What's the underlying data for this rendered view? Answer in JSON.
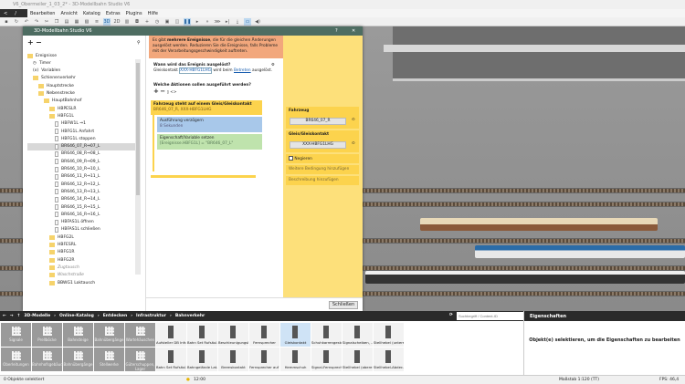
{
  "window": {
    "title": "V6_Obermeiler_1_03_2* - 3D-Modellbahn Studio V6"
  },
  "menu": [
    "Bearbeiten",
    "Ansicht",
    "Katalog",
    "Extras",
    "Plugins",
    "Hilfe"
  ],
  "dialog": {
    "title": "3D-Modellbahn Studio V6",
    "help": "?",
    "close": "✕",
    "tree": [
      {
        "label": "Ereignisse",
        "type": "folder",
        "level": 0
      },
      {
        "label": "Timer",
        "type": "timer",
        "level": 1
      },
      {
        "label": "Variablen",
        "type": "var",
        "level": 1
      },
      {
        "label": "Schienenverkehr",
        "type": "folder",
        "level": 1
      },
      {
        "label": "Hauptstrecke",
        "type": "folder",
        "level": 2
      },
      {
        "label": "Nebenstrecke",
        "type": "folder",
        "level": 2
      },
      {
        "label": "HauptBahnhof",
        "type": "folder",
        "level": 3
      },
      {
        "label": "HBPESLR",
        "type": "folder",
        "level": 4
      },
      {
        "label": "HBFG1L",
        "type": "folder",
        "level": 4
      },
      {
        "label": "HBFW1L ⇒1",
        "type": "file",
        "level": 5
      },
      {
        "label": "HBFG1L Anfahrt",
        "type": "file",
        "level": 5
      },
      {
        "label": "HBFG1L stoppen",
        "type": "file",
        "level": 5
      },
      {
        "label": "BR646_07_R⇒07_L",
        "type": "file",
        "level": 5,
        "selected": true
      },
      {
        "label": "BR646_08_R⇒08_L",
        "type": "file",
        "level": 5
      },
      {
        "label": "BR646_09_R⇒09_L",
        "type": "file",
        "level": 5
      },
      {
        "label": "BR646_10_R⇒10_L",
        "type": "file",
        "level": 5
      },
      {
        "label": "BR646_11_R⇒11_L",
        "type": "file",
        "level": 5
      },
      {
        "label": "BR646_12_R⇒12_L",
        "type": "file",
        "level": 5
      },
      {
        "label": "BR646_13_R⇒13_L",
        "type": "file",
        "level": 5
      },
      {
        "label": "BR646_14_R⇒14_L",
        "type": "file",
        "level": 5
      },
      {
        "label": "BR646_15_R⇒15_L",
        "type": "file",
        "level": 5
      },
      {
        "label": "BR646_16_R⇒16_L",
        "type": "file",
        "level": 5
      },
      {
        "label": "HBFAS1L öffnen",
        "type": "file",
        "level": 5
      },
      {
        "label": "HBFAS1L schließen",
        "type": "file",
        "level": 5
      },
      {
        "label": "HBFG2L",
        "type": "folder",
        "level": 4
      },
      {
        "label": "HBFESRL",
        "type": "folder",
        "level": 4
      },
      {
        "label": "HBFG1R",
        "type": "folder",
        "level": 4
      },
      {
        "label": "HBFG2R",
        "type": "folder",
        "level": 4
      },
      {
        "label": "Zugtausch",
        "type": "folder",
        "level": 4,
        "dim": true
      },
      {
        "label": "Waschstraße",
        "type": "folder",
        "level": 4,
        "dim": true
      },
      {
        "label": "BBWG1 Loktausch",
        "type": "folder",
        "level": 4
      }
    ],
    "banner": {
      "pre": "Es gibt ",
      "bold": "mehrere Ereignisse",
      "post": ", die für die gleichen Änderungen ausgelöst werden. Reduzieren Sie die Ereignisse, falls Probleme mit der Verarbeitungsgeschwindigkeit auftreten."
    },
    "trigger_heading": "Wann wird das Ereignis ausgelöst?",
    "trigger_pre": "Gleiskontakt ",
    "trigger_link1": "XXX-HBFG1LHG",
    "trigger_mid": " wird beim ",
    "trigger_link2": "Betreten",
    "trigger_post": " ausgelöst.",
    "actions_heading": "Welche Aktionen sollen ausgeführt werden?",
    "condition": {
      "title": "Fahrzeug steht auf einem Gleis/Gleiskontakt",
      "sub": "BR646_07_R, XXX-HBFG1LHG"
    },
    "delay": {
      "title": "Ausführung verzögern",
      "sub": "8 Sekunden"
    },
    "setvar": {
      "title": "Eigenschaft/Variable setzen",
      "sub": "[Ereignisse.HBFG1L] = \"BR646_07_L\""
    },
    "side": {
      "vehicle_label": "Fahrzeug",
      "vehicle_value": "BR646_07_R",
      "track_label": "Gleis/Gleiskontakt",
      "track_value": "XXX-HBFG1LHG",
      "negate": "Negieren",
      "add_cond": "Weitere Bedingung hinzufügen",
      "add_desc": "Beschreibung hinzufügen"
    },
    "close_button": "Schließen"
  },
  "catalog": {
    "breadcrumb": [
      "3D-Modelle",
      "Online-Katalog",
      "Entdecken",
      "Infrastruktur",
      "Bahnverkehr"
    ],
    "search_placeholder": "Suchbegriff / Content-ID",
    "categories_row1": [
      "Signale",
      "Prellböcke",
      "Bahnsteige",
      "Bahnübergänge",
      "Wartehäuschen"
    ],
    "categories_row2": [
      "Oberleitungen",
      "Bahnhofsgebäude",
      "Bahnübergänge",
      "Stellwerke",
      "Güterschuppen, Lager"
    ],
    "items_row1": [
      "Aufsteller DB Infr...",
      "Bahn Set Rufsäul...",
      "Beschleunigungsk...",
      "Fernsprecher",
      "Gleiskontakt",
      "Schuhkarrengestell",
      "Signalscheiben, ...",
      "Stellhebel (unters..."
    ],
    "items_row2": [
      "Bahn Set Rufsäul...",
      "Bahngelände Lat...",
      "Bremskontakt",
      "Fernsprecher auf ...",
      "Hemmschuh",
      "Signal-Fernsprecher",
      "Stellhebel (obere ...",
      "Stellhebel-Abdec..."
    ],
    "selected_item": "Gleiskontakt"
  },
  "properties": {
    "title": "Eigenschaften",
    "empty": "Objekt(e) selektieren, um die Eigenschaften zu bearbeiten"
  },
  "status": {
    "selection": "0 Objekte selektiert",
    "time": "12:00",
    "scale": "Maßstab 1:120 (TT)",
    "fps": "FPS: 46,4"
  }
}
